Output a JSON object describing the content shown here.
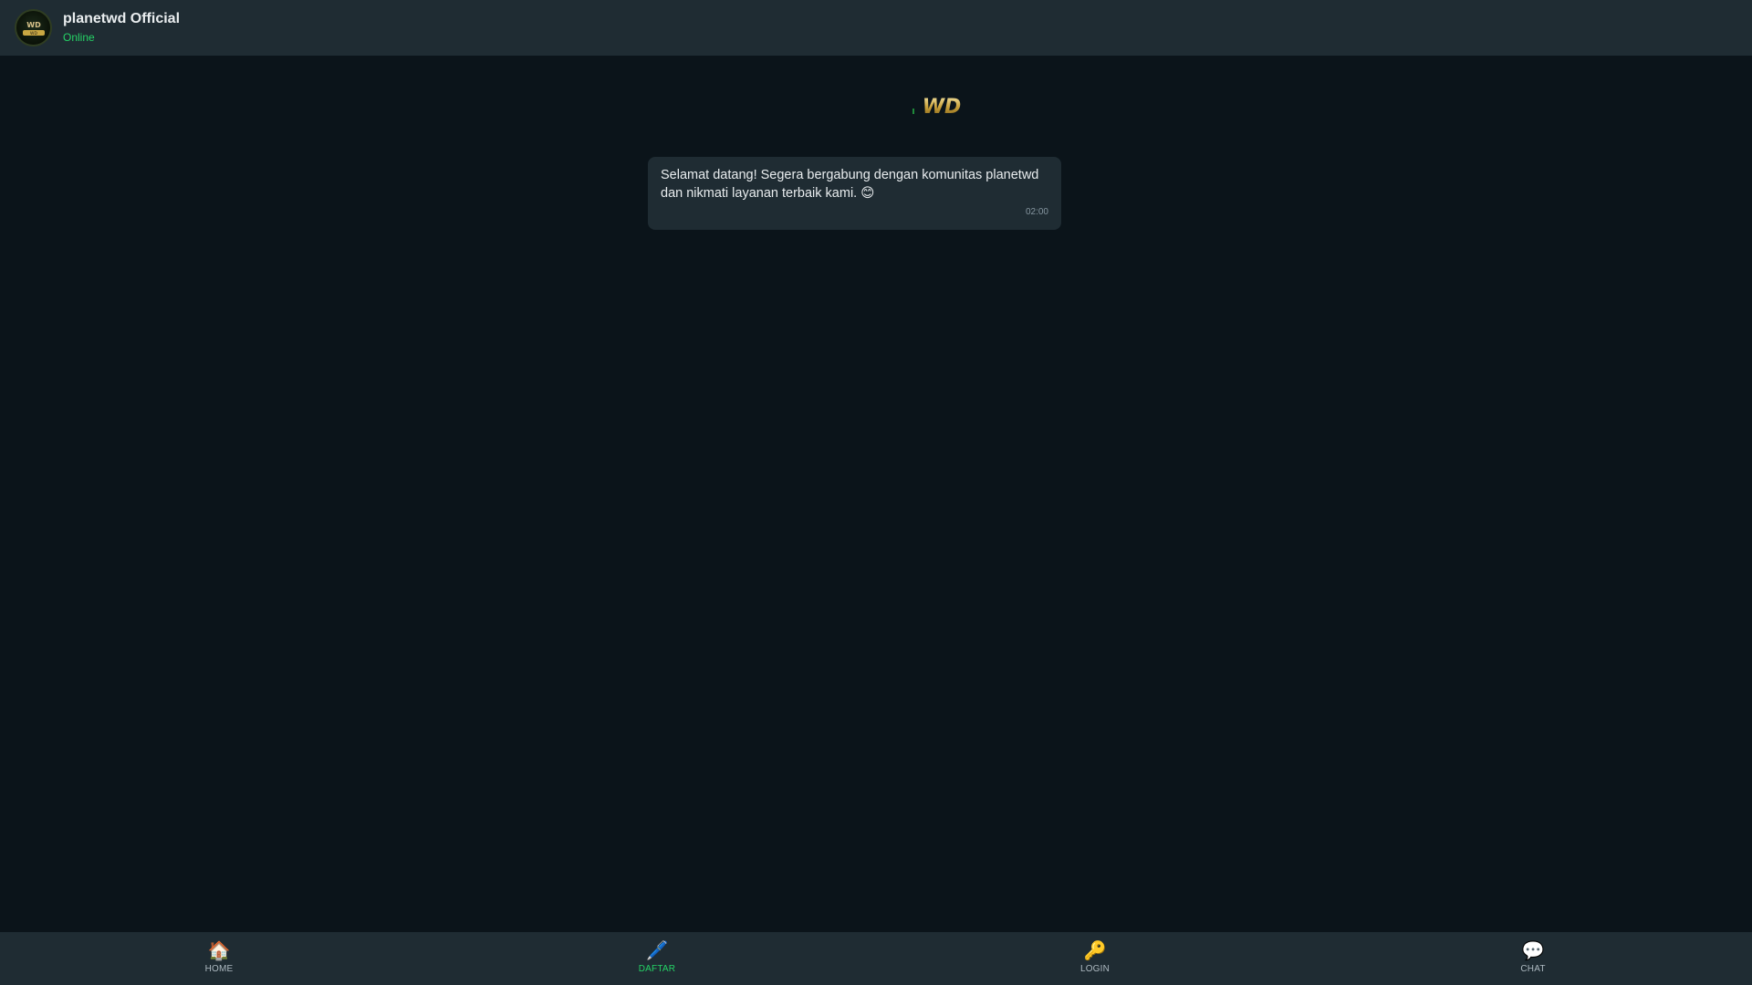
{
  "header": {
    "name": "planetwd Official",
    "status": "Online",
    "status_color": "#25d366",
    "avatar_icon": "planetwd-logo-icon"
  },
  "chat": {
    "logo_icon": "wd-gold-logo-icon",
    "messages": [
      {
        "text": "Selamat datang! Segera bergabung dengan komunitas planetwd dan nikmati layanan terbaik kami. 😊",
        "time": "02:00"
      }
    ]
  },
  "bottom_nav": {
    "items": [
      {
        "label": "HOME",
        "icon": "🏠",
        "icon_name": "home-icon",
        "active": false
      },
      {
        "label": "DAFTAR",
        "icon": "🖊️",
        "icon_name": "pen-icon",
        "active": true
      },
      {
        "label": "LOGIN",
        "icon": "🔑",
        "icon_name": "key-icon",
        "active": false
      },
      {
        "label": "CHAT",
        "icon": "💬",
        "icon_name": "chat-bubble-icon",
        "active": false
      }
    ]
  },
  "colors": {
    "background": "#0b141a",
    "panel": "#1f2c33",
    "accent": "#25d366"
  }
}
